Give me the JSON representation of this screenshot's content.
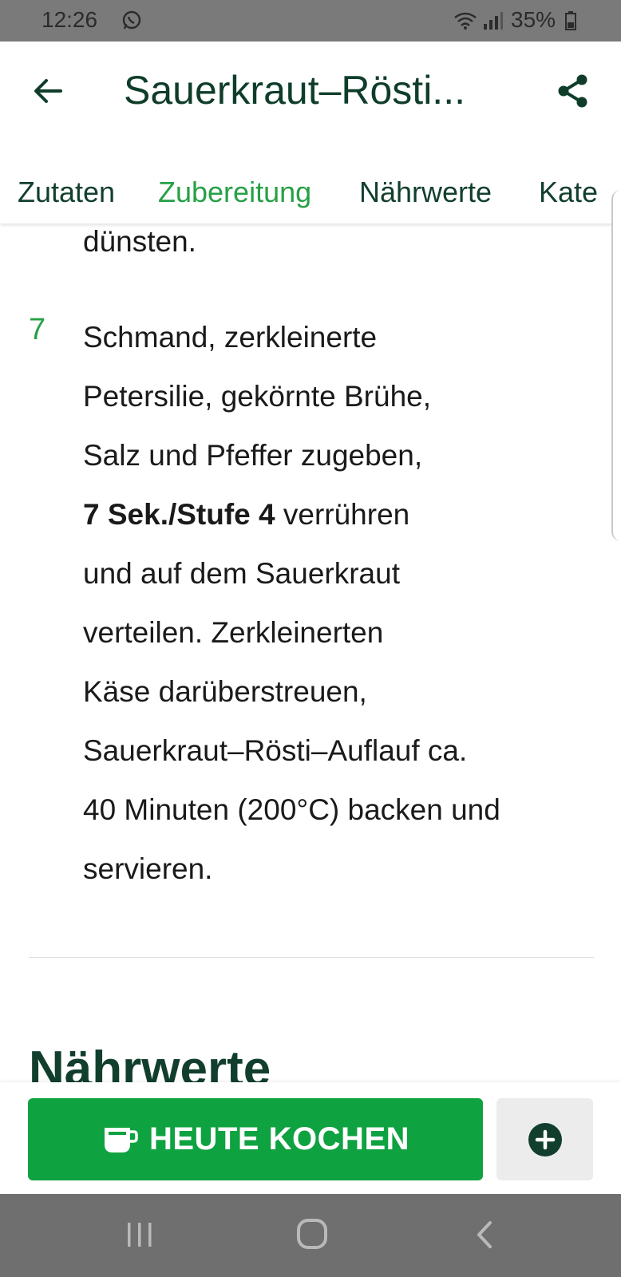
{
  "status_bar": {
    "time": "12:26",
    "battery": "35%"
  },
  "header": {
    "title": "Sauerkraut–Rösti..."
  },
  "tabs": [
    {
      "label": "Zutaten",
      "active": false
    },
    {
      "label": "Zubereitung",
      "active": true
    },
    {
      "label": "Nährwerte",
      "active": false
    },
    {
      "label": "Kate",
      "active": false
    }
  ],
  "content": {
    "prev_step_tail": "dünsten.",
    "step": {
      "number": "7",
      "lines": [
        "Schmand, zerkleinerte",
        "Petersilie, gekörnte Brühe,",
        "Salz und Pfeffer zugeben,",
        "7 Sek./Stufe 4 verrühren",
        "und auf dem Sauerkraut",
        "verteilen. Zerkleinerten",
        "Käse darüberstreuen,",
        "Sauerkraut–Rösti–Auflauf ca.",
        "40 Minuten (200°C) backen und",
        "servieren."
      ],
      "bold_text": "7 Sek./Stufe 4",
      "after_bold": " verrühren"
    },
    "section_heading": "Nährwerte"
  },
  "bottom": {
    "cook_label": "HEUTE KOCHEN"
  },
  "colors": {
    "accent": "#27a046",
    "button": "#0fa240",
    "title": "#0f3d2a"
  },
  "icons": [
    "whatsapp-icon",
    "wifi-icon",
    "signal-icon",
    "battery-icon",
    "back-arrow-icon",
    "share-icon",
    "cup-icon",
    "plus-circle-icon",
    "recent-apps-icon",
    "home-icon",
    "back-icon"
  ]
}
